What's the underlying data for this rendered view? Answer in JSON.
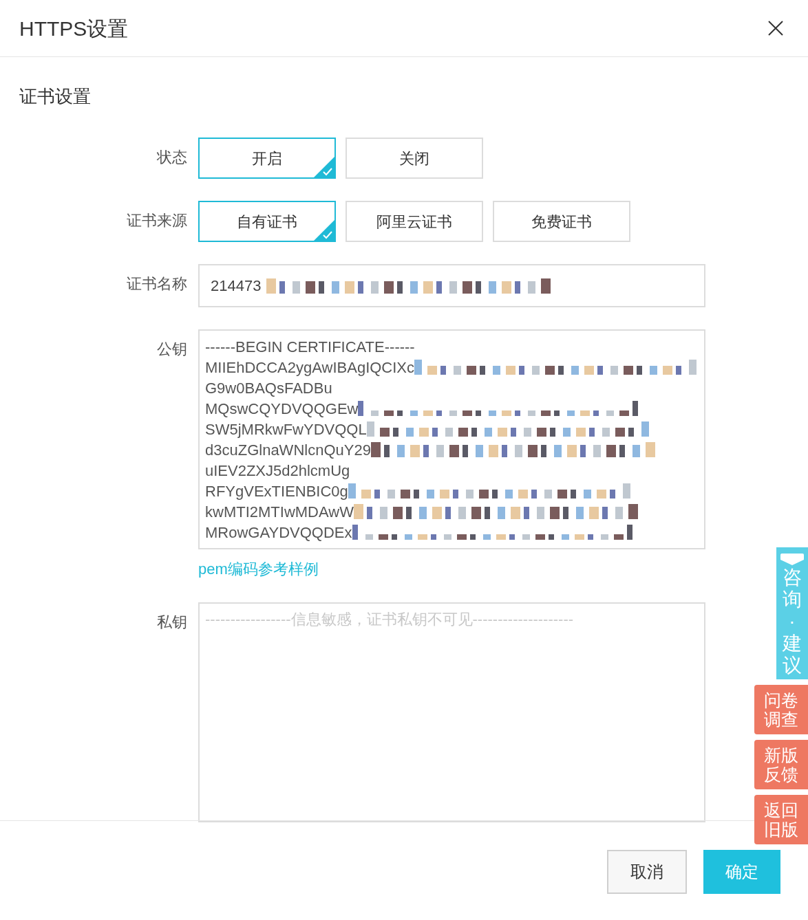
{
  "dialog": {
    "title": "HTTPS设置"
  },
  "section": {
    "title": "证书设置"
  },
  "status": {
    "label": "状态",
    "options": [
      {
        "label": "开启",
        "selected": true
      },
      {
        "label": "关闭",
        "selected": false
      }
    ]
  },
  "source": {
    "label": "证书来源",
    "options": [
      {
        "label": "自有证书",
        "selected": true
      },
      {
        "label": "阿里云证书",
        "selected": false
      },
      {
        "label": "免费证书",
        "selected": false
      }
    ]
  },
  "cert_name": {
    "label": "证书名称",
    "value": "214473"
  },
  "public_key": {
    "label": "公钥",
    "lines": [
      {
        "text": "------BEGIN CERTIFICATE------",
        "redacted": false
      },
      {
        "text": "MIIEhDCCA2ygAwIBAgIQCIXc",
        "redacted": true
      },
      {
        "text": "G9w0BAQsFADBu",
        "redacted": false
      },
      {
        "text": "MQswCQYDVQQGEw",
        "redacted": true
      },
      {
        "text": "SW5jMRkwFwYDVQQL",
        "redacted": true
      },
      {
        "text": "d3cuZGlnaWNlcnQuY29",
        "redacted": true
      },
      {
        "text": "uIEV2ZXJ5d2hlcmUg",
        "redacted": false
      },
      {
        "text": "RFYgVExTIENBIC0g",
        "redacted": true
      },
      {
        "text": "kwMTI2MTIwMDAwW",
        "redacted": true
      },
      {
        "text": "MRowGAYDVQQDEx",
        "redacted": true
      }
    ],
    "link": "pem编码参考样例"
  },
  "private_key": {
    "label": "私钥",
    "placeholder": "-----------------信息敏感，证书私钥不可见--------------------"
  },
  "footer": {
    "buttons": [
      {
        "label": "取消",
        "kind": "secondary"
      },
      {
        "label": "确定",
        "kind": "primary"
      }
    ]
  },
  "side_tabs": [
    {
      "label": "咨询·建议",
      "kind": "consult"
    },
    {
      "label": "问卷调查",
      "kind": "float"
    },
    {
      "label": "新版反馈",
      "kind": "float"
    },
    {
      "label": "返回旧版",
      "kind": "float"
    }
  ]
}
